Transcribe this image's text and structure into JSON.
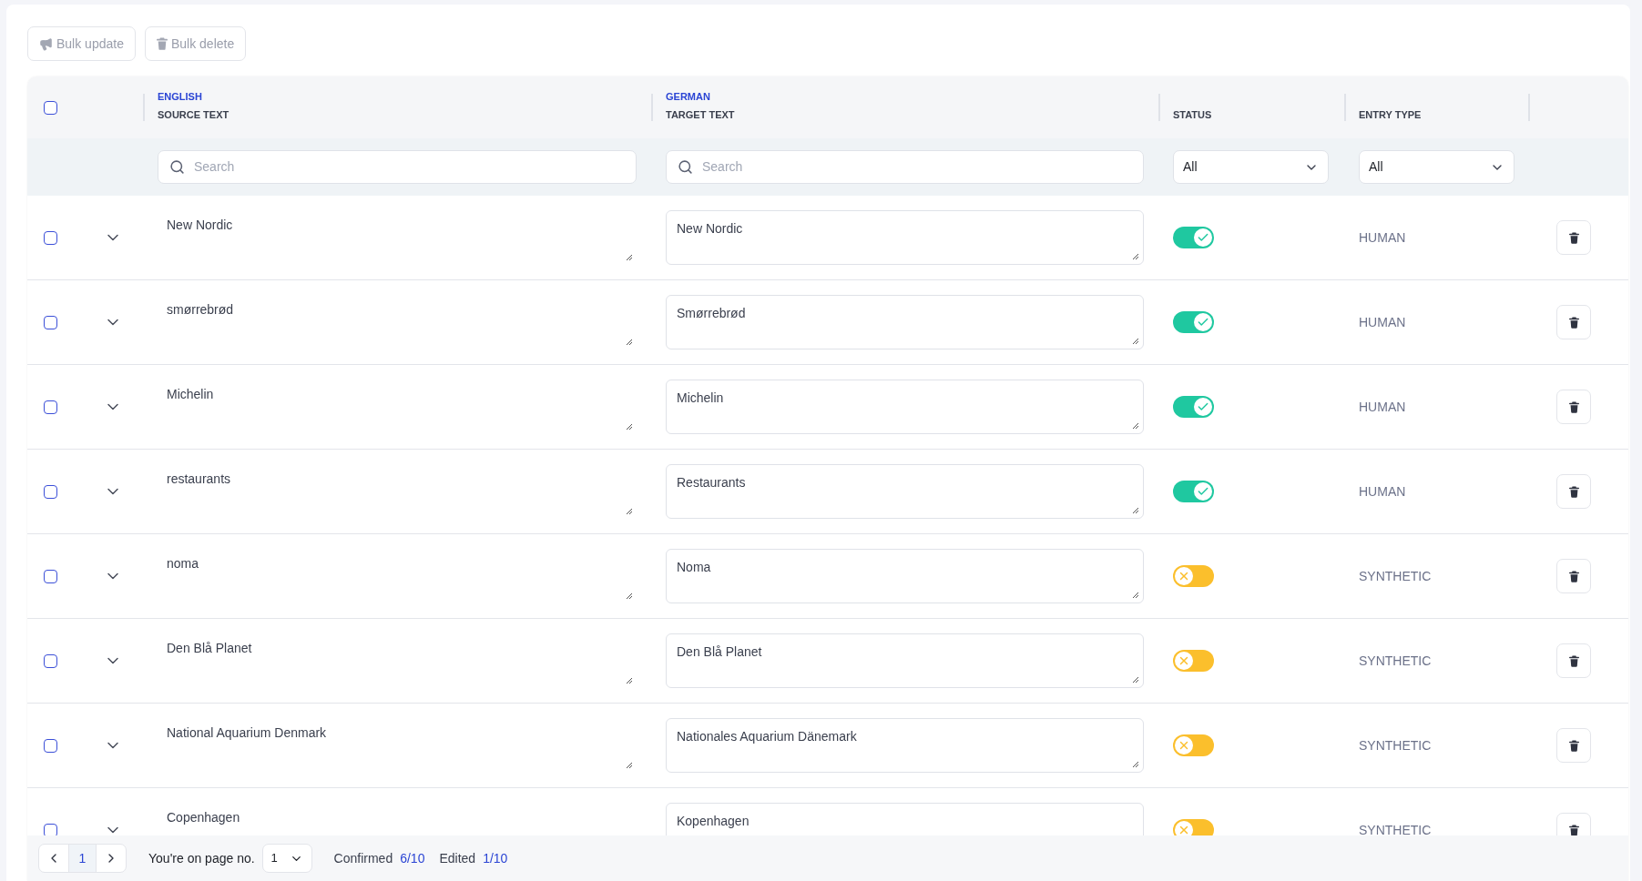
{
  "toolbar": [
    {
      "kind": "update",
      "label": "Bulk update"
    },
    {
      "kind": "delete",
      "label": "Bulk delete"
    }
  ],
  "table": {
    "select_all": {
      "checked": false
    },
    "columns": [
      {
        "kind": "source",
        "language": "ENGLISH",
        "label": "SOURCE TEXT",
        "filter": {
          "placeholder": "Search"
        }
      },
      {
        "kind": "target",
        "language": "GERMAN",
        "label": "TARGET TEXT",
        "filter": {
          "placeholder": "Search"
        }
      },
      {
        "kind": "status",
        "label": "STATUS",
        "filter": {
          "value": "All"
        }
      },
      {
        "kind": "entry_type",
        "label": "ENTRY TYPE",
        "filter": {
          "value": "All"
        }
      }
    ],
    "rows": [
      {
        "checked": false,
        "source": "New Nordic",
        "target": "New Nordic",
        "confirmed": true,
        "entry_type": "HUMAN"
      },
      {
        "checked": false,
        "source": "smørrebrød",
        "target": "Smørrebrød",
        "confirmed": true,
        "entry_type": "HUMAN"
      },
      {
        "checked": false,
        "source": "Michelin",
        "target": "Michelin",
        "confirmed": true,
        "entry_type": "HUMAN"
      },
      {
        "checked": false,
        "source": "restaurants",
        "target": "Restaurants",
        "confirmed": true,
        "entry_type": "HUMAN"
      },
      {
        "checked": false,
        "source": "noma",
        "target": "Noma",
        "confirmed": false,
        "entry_type": "SYNTHETIC"
      },
      {
        "checked": false,
        "source": "Den Blå Planet",
        "target": "Den Blå Planet",
        "confirmed": false,
        "entry_type": "SYNTHETIC"
      },
      {
        "checked": false,
        "source": "National Aquarium Denmark",
        "target": "Nationales Aquarium Dänemark",
        "confirmed": false,
        "entry_type": "SYNTHETIC"
      },
      {
        "checked": false,
        "source": "Copenhagen",
        "target": "Kopenhagen",
        "confirmed": false,
        "entry_type": "SYNTHETIC"
      }
    ]
  },
  "footer": {
    "pages": [
      {
        "label": "1",
        "selected": true
      }
    ],
    "page_label": "You're on page no.",
    "page_select": "1",
    "stats": [
      {
        "label": "Confirmed",
        "value": "6/10"
      },
      {
        "label": "Edited",
        "value": "1/10"
      }
    ]
  }
}
